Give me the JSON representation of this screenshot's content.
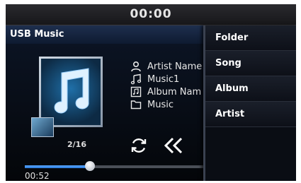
{
  "status_bar": {
    "clock": "00:00"
  },
  "header": {
    "title": "USB Music"
  },
  "track": {
    "artist": "Artist Name",
    "title": "Music1",
    "album": "Album Nam",
    "folder": "Music",
    "counter": "2/16",
    "elapsed": "00:52",
    "progress_fraction": 0.35
  },
  "icons": {
    "artist": "person-icon",
    "title": "music-note-icon",
    "album": "album-icon",
    "folder": "folder-icon",
    "repeat": "repeat-icon",
    "previous": "previous-track-icon"
  },
  "menu": {
    "items": [
      {
        "label": "Folder"
      },
      {
        "label": "Song"
      },
      {
        "label": "Album"
      },
      {
        "label": "Artist"
      }
    ]
  }
}
